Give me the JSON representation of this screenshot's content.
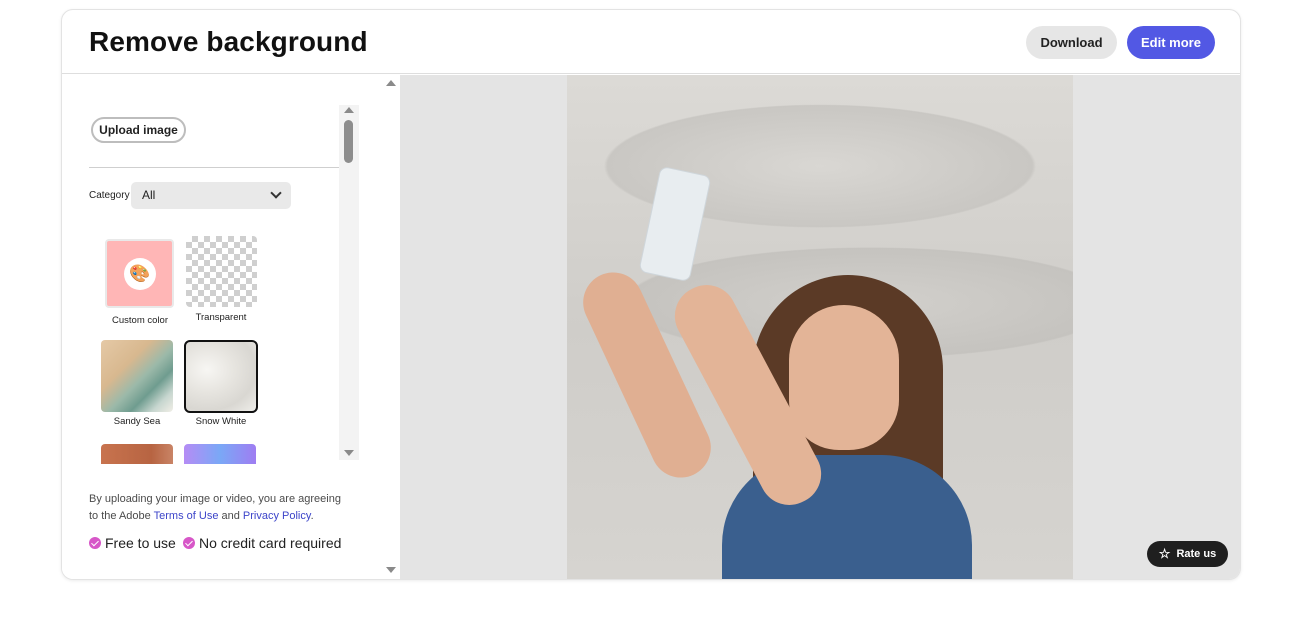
{
  "header": {
    "title": "Remove background",
    "download_label": "Download",
    "edit_more_label": "Edit more"
  },
  "sidebar": {
    "upload_label": "Upload image",
    "category_label": "Category",
    "category_value": "All",
    "swatches": [
      {
        "label": "Custom color",
        "color": "#ffb6b6",
        "icon": "palette-icon"
      },
      {
        "label": "Transparent"
      },
      {
        "label": "Sandy Sea"
      },
      {
        "label": "Snow White",
        "selected": true
      }
    ],
    "legal": {
      "prefix": "By uploading your image or video, you are agreeing to the Adobe ",
      "terms_link": "Terms of Use",
      "and": " and ",
      "privacy_link": "Privacy Policy",
      "suffix": "."
    },
    "perks": [
      "Free to use",
      "No credit card required"
    ]
  },
  "preview": {
    "rate_label": "Rate us"
  },
  "colors": {
    "accent": "#5258e4",
    "check": "#d757c8",
    "link": "#3c44c9"
  }
}
